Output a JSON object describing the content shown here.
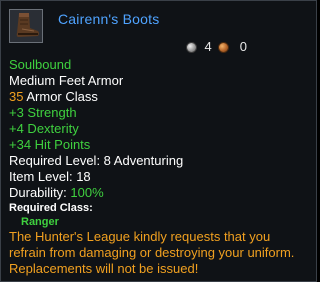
{
  "item": {
    "icon": "leather-boots-icon",
    "name": "Cairenn's Boots",
    "price": {
      "silver": "4",
      "copper": "0"
    },
    "binding": "Soulbound",
    "type": "Medium Feet Armor",
    "armor_value": "35",
    "armor_label": " Armor Class",
    "stats": [
      "+3 Strength",
      "+4 Dexterity",
      "+34 Hit Points"
    ],
    "required_level_label": "Required Level: ",
    "required_level_value": "8 Adventuring",
    "item_level_label": "Item Level: ",
    "item_level_value": "18",
    "durability_label": "Durability: ",
    "durability_value": "100%",
    "required_class_label": "Required Class:",
    "required_class_value": "Ranger",
    "flavor_text": "The Hunter's League kindly requests that you refrain from damaging or destroying your uniform. Replacements will not be issued!"
  },
  "colors": {
    "name": "#4fa3ff",
    "green": "#3fd13f",
    "orange": "#f0a020",
    "background": "#0f1216"
  }
}
